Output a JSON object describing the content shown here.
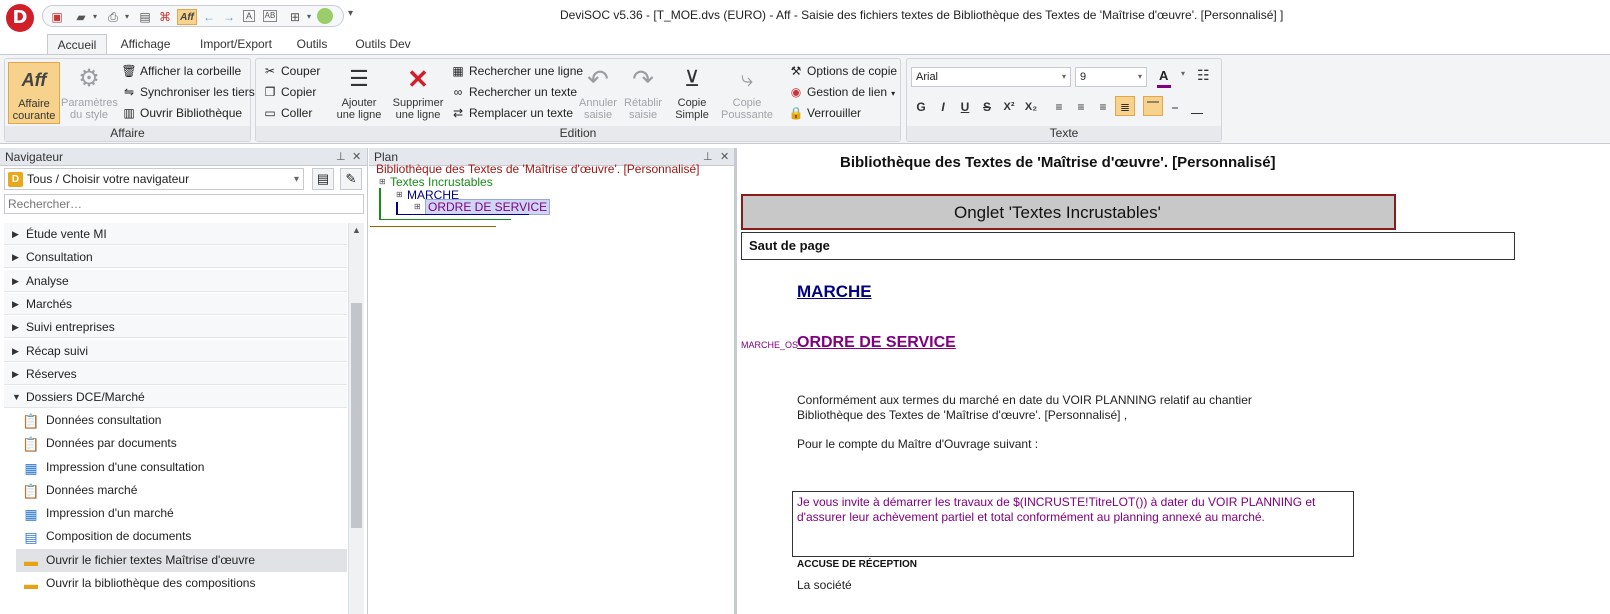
{
  "app": {
    "logo_letter": "D",
    "title": "DeviSOC v5.36 - [T_MOE.dvs (EURO) - Aff - Saisie des fichiers textes de Bibliothèque des Textes  de 'Maîtrise d'œuvre'. [Personnalisé] ]",
    "accent": "#d11f2a"
  },
  "qat": {
    "icons": [
      "new-icon",
      "open-icon",
      "print-icon",
      "page-setup-icon",
      "pdf-icon",
      "aff-icon",
      "back-icon",
      "forward-icon",
      "a-icon",
      "ab-icon",
      "window-icon",
      "globe-icon"
    ],
    "aff_label": "Aff"
  },
  "tabs": [
    "Accueil",
    "Affichage",
    "Import/Export",
    "Outils",
    "Outils Dev"
  ],
  "ribbon": {
    "affaire": {
      "label": "Affaire",
      "current": "Affaire courante",
      "current_l1": "Affaire",
      "current_l2": "courante",
      "aff_icon": "Aff",
      "style_l1": "Paramètres",
      "style_l2": "du style",
      "trash": "Afficher la corbeille",
      "sync": "Synchroniser les tiers",
      "open_lib": "Ouvrir Bibliothèque"
    },
    "edition": {
      "label": "Edition",
      "cut": "Couper",
      "copy": "Copier",
      "paste": "Coller",
      "add_l1": "Ajouter",
      "add_l2": "une ligne",
      "del_l1": "Supprimer",
      "del_l2": "une ligne",
      "find_line": "Rechercher une ligne",
      "find_text": "Rechercher un texte",
      "replace_text": "Remplacer un texte",
      "undo_l1": "Annuler",
      "undo_l2": "saisie",
      "redo_l1": "Rétablir",
      "redo_l2": "saisie",
      "copy_simple_l1": "Copie",
      "copy_simple_l2": "Simple",
      "copy_push_l1": "Copie",
      "copy_push_l2": "Poussante",
      "copy_options": "Options de copie",
      "link_mgmt": "Gestion de lien",
      "lock": "Verrouiller"
    },
    "texte": {
      "label": "Texte",
      "font": "Arial",
      "size": "9",
      "bold": "G",
      "italic": "I",
      "underline": "U",
      "strike": "S",
      "sup": "X²",
      "sub": "X₂"
    }
  },
  "navigator": {
    "title": "Navigateur",
    "selector": "Tous / Choisir votre navigateur",
    "search_placeholder": "Rechercher…",
    "items": [
      "Étude vente MI",
      "Consultation",
      "Analyse",
      "Marchés",
      "Suivi entreprises",
      "Récap suivi",
      "Réserves",
      "Dossiers DCE/Marché"
    ],
    "subitems": [
      "Données consultation",
      "Données par documents",
      "Impression d'une consultation",
      "Données marché",
      "Impression d'un marché",
      "Composition de documents",
      "Ouvrir le fichier textes Maîtrise d'œuvre",
      "Ouvrir la bibliothèque des compositions"
    ]
  },
  "plan": {
    "title": "Plan",
    "root": "Bibliothèque des Textes  de 'Maîtrise d'œuvre'. [Personnalisé]",
    "n1": "Textes Incrustables",
    "n2": "MARCHE",
    "n3": "ORDRE DE SERVICE"
  },
  "document": {
    "heading": "Bibliothèque des Textes  de 'Maîtrise d'œuvre'. [Personnalisé]",
    "onglet": "Onglet 'Textes Incrustables'",
    "saut": "Saut de page",
    "marche": "MARCHE",
    "os_tag": "MARCHE_OS",
    "os_title": "ORDRE DE SERVICE",
    "p1": "Conformément aux termes du marché en date du VOIR PLANNING relatif au chantier",
    "p2": "Bibliothèque des Textes  de 'Maîtrise d'œuvre'. [Personnalisé] ,",
    "p3": "Pour le compte du Maître d'Ouvrage suivant  :",
    "box_l1": "Je vous invite à démarrer les travaux de $(INCRUSTE!TitreLOT()) à dater du VOIR PLANNING et",
    "box_l2": "d'assurer leur achèvement partiel et total conformément au planning annexé au marché.",
    "accuse": "ACCUSE DE RÉCEPTION",
    "societe": "La société"
  }
}
